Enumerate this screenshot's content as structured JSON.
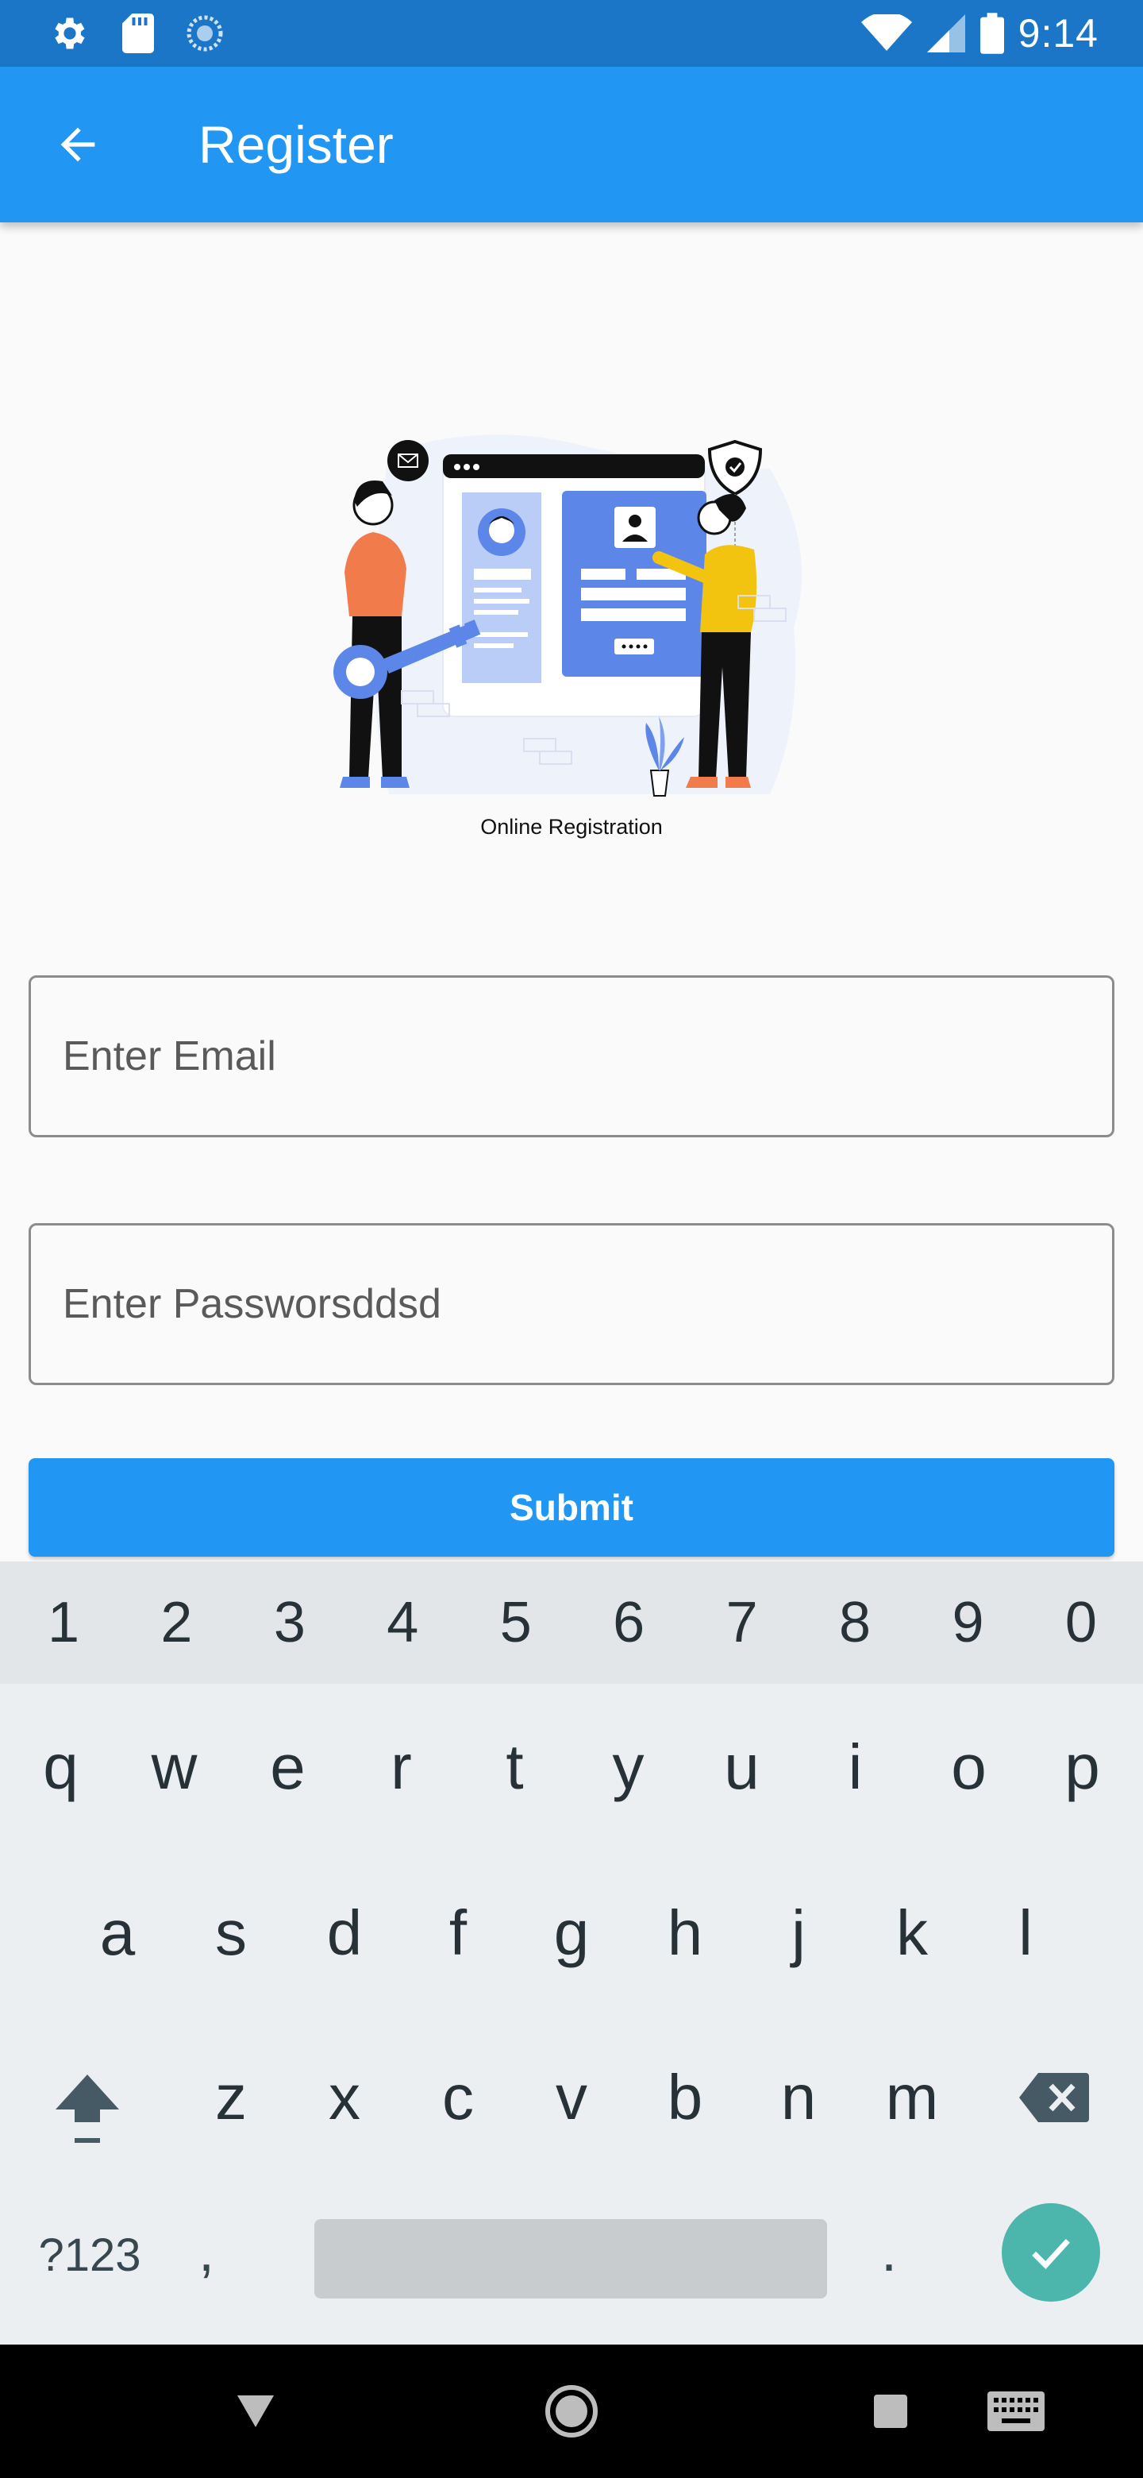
{
  "status_bar": {
    "time": "9:14",
    "icons_left": [
      "settings-icon",
      "sd-card-icon",
      "sync-icon"
    ],
    "icons_right": [
      "wifi-icon",
      "signal-icon",
      "battery-icon"
    ]
  },
  "app_bar": {
    "title": "Register",
    "back_icon": "arrow-back-icon"
  },
  "illustration": {
    "caption": "Online Registration"
  },
  "form": {
    "email_placeholder": "Enter Email",
    "password_placeholder": "Enter Passworsddsd",
    "submit_label": "Submit"
  },
  "keyboard": {
    "numbers": [
      "1",
      "2",
      "3",
      "4",
      "5",
      "6",
      "7",
      "8",
      "9",
      "0"
    ],
    "row1": [
      "q",
      "w",
      "e",
      "r",
      "t",
      "y",
      "u",
      "i",
      "o",
      "p"
    ],
    "row2": [
      "a",
      "s",
      "d",
      "f",
      "g",
      "h",
      "j",
      "k",
      "l"
    ],
    "row3": [
      "z",
      "x",
      "c",
      "v",
      "b",
      "n",
      "m"
    ],
    "symbols_label": "?123",
    "comma": ",",
    "period": "."
  },
  "colors": {
    "status_bar": "#1b76c8",
    "app_bar": "#2196f3",
    "submit": "#2196f3",
    "enter_key": "#4db6ac"
  }
}
